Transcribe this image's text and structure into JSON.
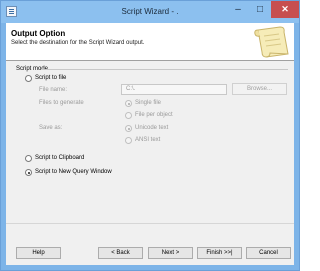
{
  "window": {
    "title": "Script Wizard - ."
  },
  "banner": {
    "title": "Output Option",
    "subtitle": "Select the destination for the Script Wizard output."
  },
  "section": {
    "label": "Script mode"
  },
  "options": {
    "script_to_file": "Script to file",
    "file_name_label": "File name:",
    "file_name_value": "C:\\.",
    "browse": "Browse...",
    "files_to_generate_label": "Files to generate",
    "single_file": "Single file",
    "file_per_object": "File per object",
    "save_as_label": "Save as:",
    "unicode_text": "Unicode text",
    "ansi_text": "ANSI text",
    "script_to_clipboard": "Script to Clipboard",
    "script_to_new_query_window": "Script to New Query Window"
  },
  "buttons": {
    "help": "Help",
    "back": "< Back",
    "next": "Next >",
    "finish": "Finish >>|",
    "cancel": "Cancel"
  },
  "colors": {
    "frame": "#7db4e8",
    "close": "#c74f4f"
  },
  "icons": {
    "app": "document-icon",
    "banner": "scroll-icon"
  }
}
